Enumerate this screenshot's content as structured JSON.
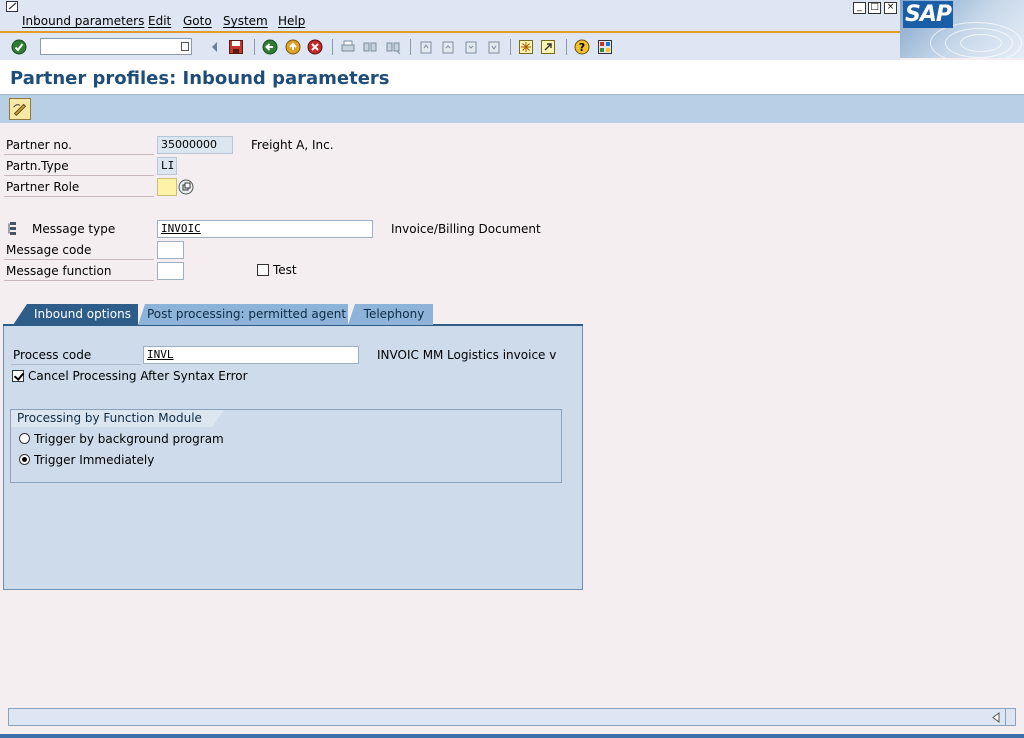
{
  "menu": {
    "items": [
      "Inbound parameters",
      "Edit",
      "Goto",
      "System",
      "Help"
    ],
    "window_buttons": [
      "_",
      "□",
      "×"
    ],
    "logo_text": "SAP"
  },
  "toolbar": {
    "command_field_value": "",
    "icons": [
      "enter-icon",
      "command-dropdown-icon",
      "back-nav-icon",
      "save-icon",
      "back-icon",
      "exit-icon",
      "cancel-icon",
      "print-icon",
      "find-icon",
      "find-next-icon",
      "first-page-icon",
      "previous-page-icon",
      "next-page-icon",
      "last-page-icon",
      "create-session-icon",
      "create-shortcut-icon",
      "help-icon",
      "layout-menu-icon"
    ]
  },
  "title": "Partner profiles: Inbound parameters",
  "app_toolbar": {
    "icons": [
      "display-change-icon"
    ]
  },
  "form": {
    "partner_no_label": "Partner no.",
    "partner_no_value": "35000000",
    "partner_name": "Freight A, Inc.",
    "partner_type_label": "Partn.Type",
    "partner_type_value": "LI",
    "partner_role_label": "Partner Role",
    "partner_role_value": "",
    "message_type_label": "Message type",
    "message_type_value": "INVOIC",
    "message_type_desc": "Invoice/Billing Document",
    "message_code_label": "Message code",
    "message_code_value": "",
    "message_function_label": "Message function",
    "message_function_value": "",
    "test_label": "Test",
    "test_checked": false
  },
  "tabs": [
    {
      "label": "Inbound options",
      "active": true
    },
    {
      "label": "Post processing: permitted agent",
      "active": false
    },
    {
      "label": "Telephony",
      "active": false
    }
  ],
  "inbound_options": {
    "process_code_label": "Process code",
    "process_code_value": "INVL",
    "process_code_desc1": "INVOIC MM",
    "process_code_desc2": "Logistics invoice ver",
    "cancel_processing_label": "Cancel Processing After Syntax Error",
    "cancel_processing_checked": true,
    "group_title": "Processing by Function Module",
    "radio_background_label": "Trigger by background program",
    "radio_immediately_label": "Trigger Immediately",
    "selected": "immediately"
  },
  "colors": {
    "title": "#1f4d7a",
    "active_tab": "#2f5d8a",
    "inactive_tab": "#8db3d8",
    "panel": "#cddbeb",
    "required_field": "#fdf2a6",
    "toolbar_accent": "#e59a2e"
  }
}
